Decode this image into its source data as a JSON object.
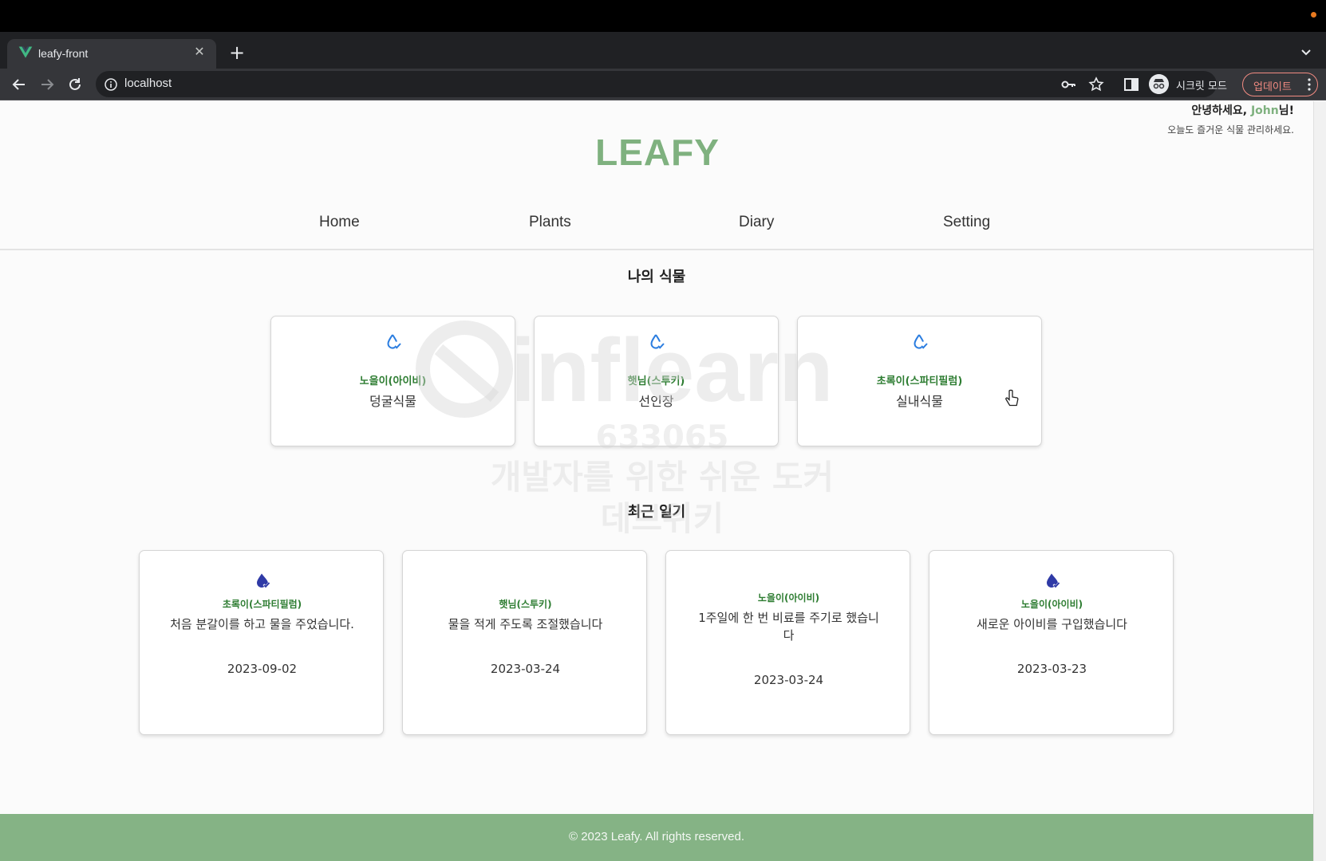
{
  "browser": {
    "tab_title": "leafy-front",
    "url": "localhost",
    "incognito_label": "시크릿 모드",
    "update_label": "업데이트"
  },
  "header": {
    "greeting_prefix": "안녕하세요, ",
    "user_name": "John",
    "greeting_suffix": "님!",
    "subtitle": "오늘도 즐거운 식물 관리하세요.",
    "logo": "LEAFY"
  },
  "nav": {
    "items": [
      {
        "label": "Home"
      },
      {
        "label": "Plants"
      },
      {
        "label": "Diary"
      },
      {
        "label": "Setting"
      }
    ]
  },
  "my_plants": {
    "title": "나의 식물",
    "items": [
      {
        "name": "노을이(아이비)",
        "type": "덩굴식물",
        "icon": "water-drop-check-outline-icon"
      },
      {
        "name": "햇님(스투키)",
        "type": "선인장",
        "icon": "water-drop-check-outline-icon"
      },
      {
        "name": "초록이(스파티필럼)",
        "type": "실내식물",
        "icon": "water-drop-check-outline-icon"
      }
    ]
  },
  "recent_diary": {
    "title": "최근 일기",
    "items": [
      {
        "plant": "초록이(스파티필럼)",
        "text": "처음 분갈이를 하고 물을 주었습니다.",
        "date": "2023-09-02",
        "icon": "water-drop-check-filled-icon"
      },
      {
        "plant": "햇님(스투키)",
        "text": "물을 적게 주도록 조절했습니다",
        "date": "2023-03-24"
      },
      {
        "plant": "노을이(아이비)",
        "text": "1주일에 한 번 비료를 주기로 했습니다",
        "date": "2023-03-24"
      },
      {
        "plant": "노을이(아이비)",
        "text": "새로운 아이비를 구입했습니다",
        "date": "2023-03-23",
        "icon": "water-drop-check-filled-icon"
      }
    ]
  },
  "footer": {
    "text": "© 2023 Leafy. All rights reserved."
  },
  "watermark": {
    "brand": "inflearn",
    "code": "633065",
    "line1": "개발자를 위한 쉬운 도커",
    "line2": "데브위키"
  },
  "colors": {
    "brand_green": "#7fb17f",
    "footer_green": "#85b385",
    "plant_name_green": "#2e7d32",
    "drop_blue": "#2b7de0",
    "drop_navy": "#2f3aa6"
  }
}
